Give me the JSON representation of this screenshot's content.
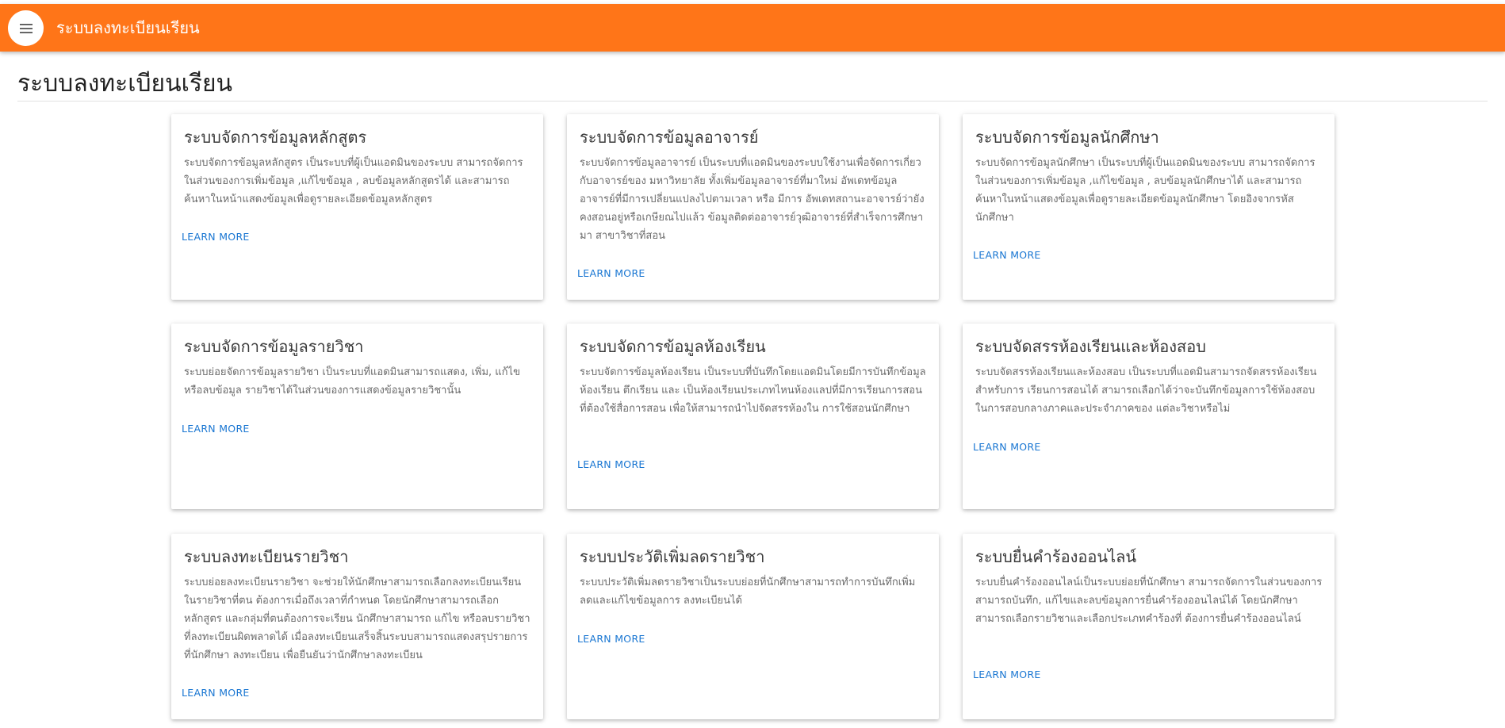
{
  "appbar": {
    "title": "ระบบลงทะเบียนเรียน",
    "menu_icon": "menu-icon",
    "color": "#ff7518"
  },
  "page": {
    "title": "ระบบลงทะเบียนเรียน"
  },
  "cards": [
    {
      "title": "ระบบจัดการข้อมูลหลักสูตร",
      "description": "ระบบจัดการข้อมูลหลักสูตร เป็นระบบที่ผู้เป็นแอดมินของระบบ สามารถจัดการในส่วนของการเพิ่มข้อมูล ,แก้ไขข้อมูล , ลบข้อมูลหลักสูตรได้ และสามารถค้นหาในหน้าแสดงข้อมูลเพื่อดูรายละเอียดข้อมูลหลักสูตร",
      "action": "LEARN MORE"
    },
    {
      "title": "ระบบจัดการข้อมูลอาจารย์",
      "description": "ระบบจัดการข้อมูลอาจารย์ เป็นระบบที่แอดมินของระบบใช้งานเพื่อจัดการเกี่ยวกับอาจารย์ของ มหาวิทยาลัย ทั้งเพิ่มข้อมูลอาจารย์ที่มาใหม่ อัพเดทข้อมูลอาจารย์ที่มีการเปลี่ยนแปลงไปตามเวลา หรือ มีการ อัพเดทสถานะอาจารย์ว่ายังคงสอนอยู่หรือเกษียณไปแล้ว ข้อมูลติดต่ออาจารย์วุฒิอาจารย์ที่สำเร็จการศึกษามา สาขาวิชาที่สอน",
      "action": "LEARN MORE"
    },
    {
      "title": "ระบบจัดการข้อมูลนักศึกษา",
      "description": "ระบบจัดการข้อมูลนักศึกษา เป็นระบบที่ผู้เป็นแอดมินของระบบ สามารถจัดการในส่วนของการเพิ่มข้อมูล ,แก้ไขข้อมูล , ลบข้อมูลนักศึกษาได้ และสามารถค้นหาในหน้าแสดงข้อมูลเพื่อดูรายละเอียดข้อมูลนักศึกษา โดยอิงจากรหัสนักศึกษา",
      "action": "LEARN MORE"
    },
    {
      "title": "ระบบจัดการข้อมูลรายวิชา",
      "description": "ระบบย่อยจัดการข้อมูลรายวิชา เป็นระบบที่แอดมินสามารถแสดง, เพิ่ม, แก้ไข หรือลบข้อมูล รายวิชาได้ในส่วนของการแสดงข้อมูลรายวิชานั้น",
      "action": "LEARN MORE"
    },
    {
      "title": "ระบบจัดการข้อมูลห้องเรียน",
      "description": "ระบบจัดการข้อมูลห้องเรียน เป็นระบบที่บันทึกโดยแอดมินโดยมีการบันทึกข้อมูลห้องเรียน ตึกเรียน และ เป็นห้องเรียนประเภทไหนห้องแลปที่มีการเรียนการสอนที่ต้องใช้สื่อการสอน เพื่อให้สามารถนำไปจัดสรรห้องใน การใช้สอนนักศึกษา",
      "action": "LEARN MORE"
    },
    {
      "title": "ระบบจัดสรรห้องเรียนและห้องสอบ",
      "description": "ระบบจัดสรรห้องเรียนและห้องสอบ เป็นระบบที่แอดมินสามารถจัดสรรห้องเรียนสำหรับการ เรียนการสอนได้ สามารถเลือกได้ว่าจะบันทึกข้อมูลการใช้ห้องสอบในการสอบกลางภาคและประจำภาคของ แต่ละวิชาหรือไม่",
      "action": "LEARN MORE"
    },
    {
      "title": "ระบบลงทะเบียนรายวิชา",
      "description": "ระบบย่อยลงทะเบียนรายวิชา จะช่วยให้นักศึกษาสามารถเลือกลงทะเบียนเรียนในรายวิชาที่ตน ต้องการเมื่อถึงเวลาที่กำหนด โดยนักศึกษาสามารถเลือกหลักสูตร และกลุ่มที่ตนต้องการจะเรียน นักศึกษาสามารถ แก้ไข หรือลบรายวิชาที่ลงทะเบียนผิดพลาดได้ เมื่อลงทะเบียนเสร็จสิ้นระบบสามารถแสดงสรุปรายการที่นักศึกษา ลงทะเบียน เพื่อยืนยันว่านักศึกษาลงทะเบียน",
      "action": "LEARN MORE"
    },
    {
      "title": "ระบบประวัติเพิ่มลดรายวิชา",
      "description": "ระบบประวัติเพิ่มลดรายวิชาเป็นระบบย่อยที่นักศึกษาสามารถทำการบันทึกเพิ่ม ลดและแก้ไขข้อมูลการ ลงทะเบียนได้",
      "action": "LEARN MORE"
    },
    {
      "title": "ระบบยื่นคำร้องออนไลน์",
      "description": "ระบบยื่นคำร้องออนไลน์เป็นระบบย่อยที่นักศึกษา สามารถจัดการในส่วนของการสามารถบันทึก, แก้ไขและลบข้อมูลการยื่นคำร้องออนไลน์ได้ โดยนักศึกษาสามารถเลือกรายวิชาและเลือกประเภทคำร้องที่ ต้องการยื่นคำร้องออนไลน์",
      "action": "LEARN MORE"
    }
  ]
}
